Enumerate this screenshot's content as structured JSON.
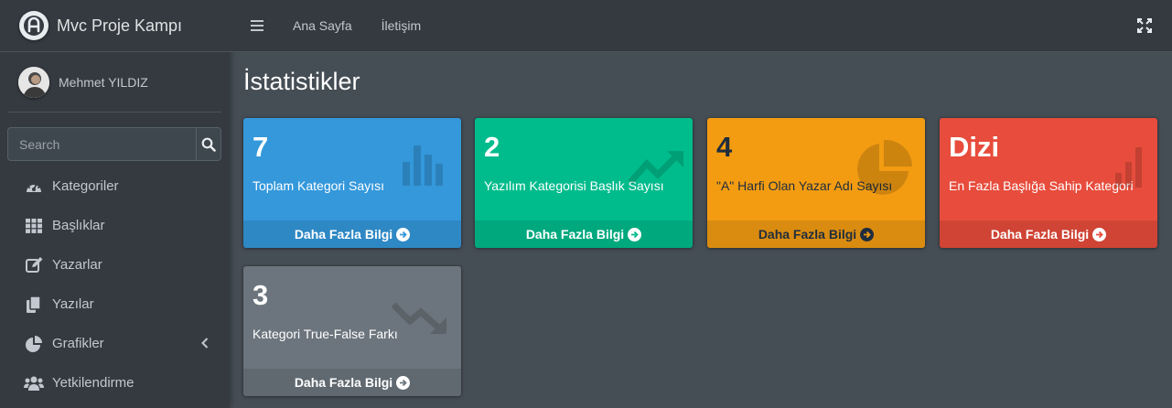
{
  "brand": {
    "name": "Mvc Proje Kampı",
    "logo_letter": "A"
  },
  "user": {
    "name": "Mehmet YILDIZ"
  },
  "search": {
    "placeholder": "Search"
  },
  "sidebar": {
    "items": [
      {
        "label": "Kategoriler",
        "icon": "tachometer-icon"
      },
      {
        "label": "Başlıklar",
        "icon": "grid-icon"
      },
      {
        "label": "Yazarlar",
        "icon": "edit-icon"
      },
      {
        "label": "Yazılar",
        "icon": "copy-icon"
      },
      {
        "label": "Grafikler",
        "icon": "pie-chart-icon",
        "has_submenu": true
      },
      {
        "label": "Yetkilendirme",
        "icon": "users-icon"
      }
    ]
  },
  "topnav": {
    "home": "Ana Sayfa",
    "contact": "İletişim"
  },
  "page": {
    "title": "İstatistikler"
  },
  "cards": [
    {
      "value": "7",
      "label": "Toplam Kategori Sayısı",
      "footer": "Daha Fazla Bilgi",
      "color": "#3498db",
      "icon": "bar-chart-icon"
    },
    {
      "value": "2",
      "label": "Yazılım Kategorisi Başlık Sayısı",
      "footer": "Daha Fazla Bilgi",
      "color": "#00bc8c",
      "icon": "trend-up-icon"
    },
    {
      "value": "4",
      "label": "\"A\" Harfi Olan Yazar Adı Sayısı",
      "footer": "Daha Fazla Bilgi",
      "color": "#f39c12",
      "icon": "pie-chart-icon"
    },
    {
      "value": "Dizi",
      "label": "En Fazla Başlığa Sahip Kategori",
      "footer": "Daha Fazla Bilgi",
      "color": "#e74c3c",
      "icon": "signal-icon"
    },
    {
      "value": "3",
      "label": "Kategori True-False Farkı",
      "footer": "Daha Fazla Bilgi",
      "color": "#6c757d",
      "icon": "trend-down-icon"
    }
  ]
}
